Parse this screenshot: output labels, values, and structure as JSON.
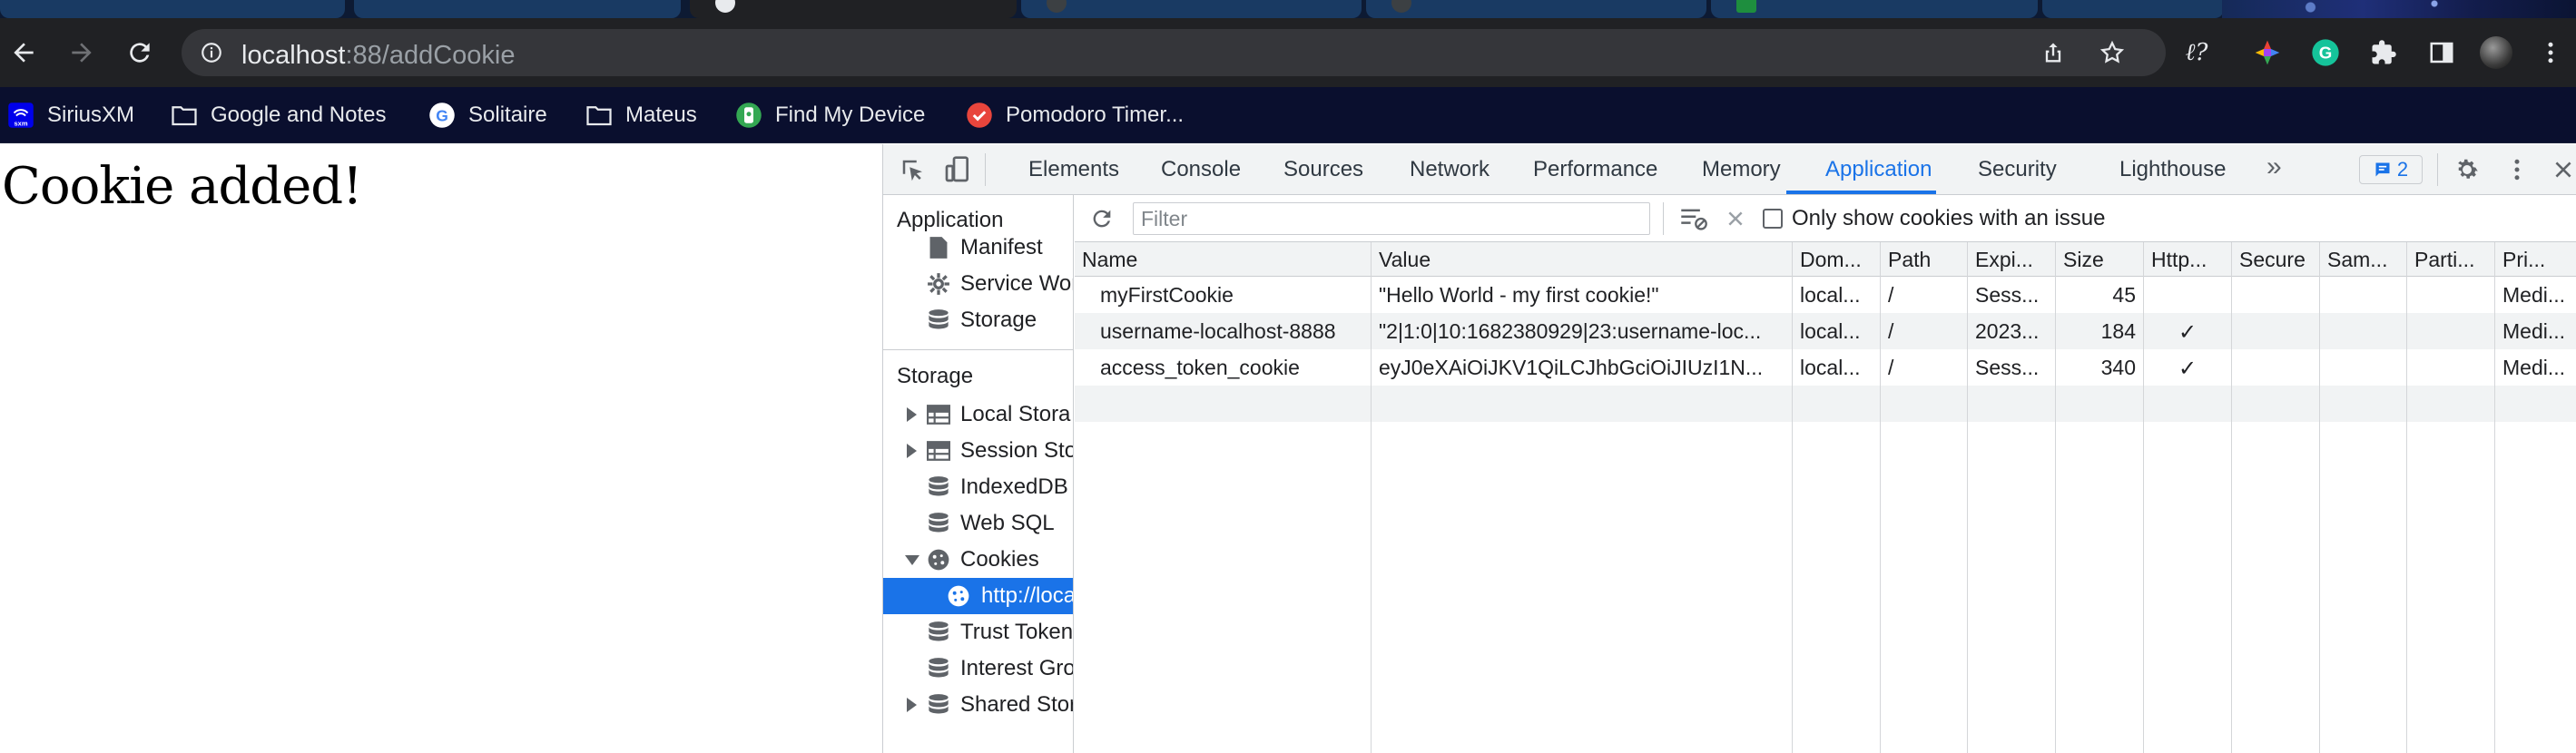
{
  "browser": {
    "address_host": "localhost",
    "address_path": ":88/addCookie",
    "tabs_active_index": 2
  },
  "bookmarks": [
    {
      "label": "SiriusXM",
      "icon": "siriusxm-icon"
    },
    {
      "label": "Google and Notes",
      "icon": "folder-icon"
    },
    {
      "label": "Solitaire",
      "icon": "google-icon"
    },
    {
      "label": "Mateus",
      "icon": "folder-icon"
    },
    {
      "label": "Find My Device",
      "icon": "find-my-device-icon"
    },
    {
      "label": "Pomodoro Timer...",
      "icon": "pomodoro-icon"
    }
  ],
  "page": {
    "heading": "Cookie added!"
  },
  "devtools": {
    "tabs": [
      "Elements",
      "Console",
      "Sources",
      "Network",
      "Performance",
      "Memory",
      "Application",
      "Security",
      "Lighthouse"
    ],
    "selected_tab": "Application",
    "issues_count": "2",
    "sidebar": {
      "application_header": "Application",
      "application_items": [
        "Manifest",
        "Service Wor",
        "Storage"
      ],
      "storage_header": "Storage",
      "storage_items": [
        "Local Stora",
        "Session Sto",
        "IndexedDB",
        "Web SQL",
        "Cookies",
        "http://loca",
        "Trust Token",
        "Interest Gro",
        "Shared Stor"
      ]
    },
    "cookies": {
      "filter_placeholder": "Filter",
      "only_issues_label": "Only show cookies with an issue",
      "columns": [
        "Name",
        "Value",
        "Dom...",
        "Path",
        "Expi...",
        "Size",
        "Http...",
        "Secure",
        "Sam...",
        "Parti...",
        "Pri..."
      ],
      "rows": [
        {
          "name": "myFirstCookie",
          "value": "\"Hello World - my first cookie!\"",
          "domain": "local...",
          "path": "/",
          "expires": "Sess...",
          "size": "45",
          "http": "",
          "secure": "",
          "samesite": "",
          "partition": "",
          "priority": "Medi..."
        },
        {
          "name": "username-localhost-8888",
          "value": "\"2|1:0|10:1682380929|23:username-loc...",
          "domain": "local...",
          "path": "/",
          "expires": "2023...",
          "size": "184",
          "http": "✓",
          "secure": "",
          "samesite": "",
          "partition": "",
          "priority": "Medi..."
        },
        {
          "name": "access_token_cookie",
          "value": "eyJ0eXAiOiJKV1QiLCJhbGciOiJIUzI1N...",
          "domain": "local...",
          "path": "/",
          "expires": "Sess...",
          "size": "340",
          "http": "✓",
          "secure": "",
          "samesite": "",
          "partition": "",
          "priority": "Medi..."
        }
      ]
    }
  },
  "colors": {
    "accent": "#1a73e8",
    "toolbar_bg": "#202124",
    "bookmarks_bg": "#0a0f2e"
  }
}
